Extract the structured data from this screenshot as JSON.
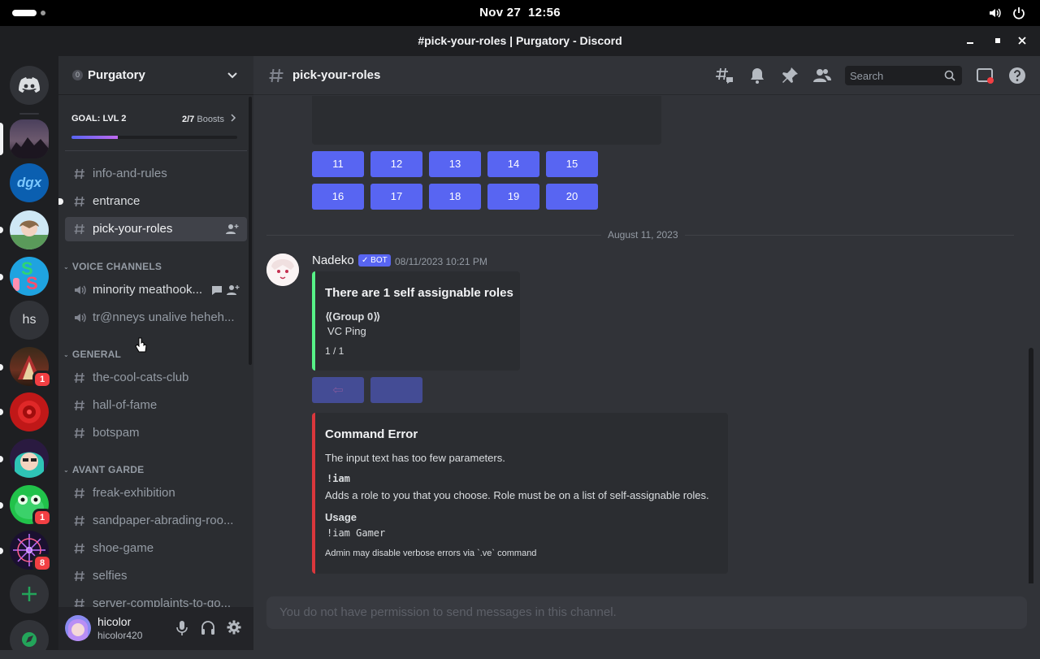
{
  "os": {
    "date": "Nov 27",
    "time": "12:56"
  },
  "window": {
    "title": "#pick-your-roles | Purgatory - Discord"
  },
  "servers": {
    "badges": [
      "1",
      "1",
      "8"
    ],
    "hs_label": "hs",
    "dgx_label": "dgx"
  },
  "guild": {
    "name": "Purgatory",
    "boost_count_icon": "0",
    "goal_label": "GOAL: LVL 2",
    "boost_current": "2/7",
    "boost_word": "Boosts",
    "boost_progress": 0.28
  },
  "channels": {
    "text_top": [
      {
        "label": "info-and-rules"
      },
      {
        "label": "entrance"
      },
      {
        "label": "pick-your-roles"
      }
    ],
    "voice_category": "VOICE CHANNELS",
    "voice": [
      {
        "label": "minority meathook..."
      },
      {
        "label": "tr@nneys unalive heheh..."
      }
    ],
    "general_category": "GENERAL",
    "general": [
      {
        "label": "the-cool-cats-club"
      },
      {
        "label": "hall-of-fame"
      },
      {
        "label": "botspam"
      }
    ],
    "avant_category": "AVANT GARDE",
    "avant": [
      {
        "label": "freak-exhibition"
      },
      {
        "label": "sandpaper-abrading-roo..."
      },
      {
        "label": "shoe-game"
      },
      {
        "label": "selfies"
      },
      {
        "label": "server-complaints-to-go..."
      }
    ]
  },
  "user": {
    "name": "hicolor",
    "tag": "hicolor420"
  },
  "chat": {
    "channel_name": "pick-your-roles",
    "search_placeholder": "Search",
    "number_buttons_row1": [
      "11",
      "12",
      "13",
      "14",
      "15"
    ],
    "number_buttons_row2": [
      "16",
      "17",
      "18",
      "19",
      "20"
    ],
    "date_divider": "August 11, 2023",
    "message": {
      "author": "Nadeko",
      "bot_tag": "✓ BOT",
      "timestamp": "08/11/2023 10:21 PM",
      "roles_embed": {
        "title": "There are 1 self assignable roles",
        "group": "⟪Group 0⟫",
        "role": "VC Ping",
        "page": "1 / 1",
        "accent": "#57f287"
      },
      "prev_button_icon": "⇦",
      "error_embed": {
        "title": "Command Error",
        "description": "The input text has too few parameters.",
        "command": "!iam",
        "command_desc": "Adds a role to you that you choose. Role must be on a list of self-assignable roles.",
        "usage_label": "Usage",
        "usage_example": "!iam Gamer",
        "footer": "Admin may disable verbose errors via `.ve` command",
        "accent": "#da373c"
      }
    },
    "composer_placeholder": "You do not have permission to send messages in this channel."
  },
  "colors": {
    "blurple": "#5865f2",
    "green": "#23a55a"
  }
}
